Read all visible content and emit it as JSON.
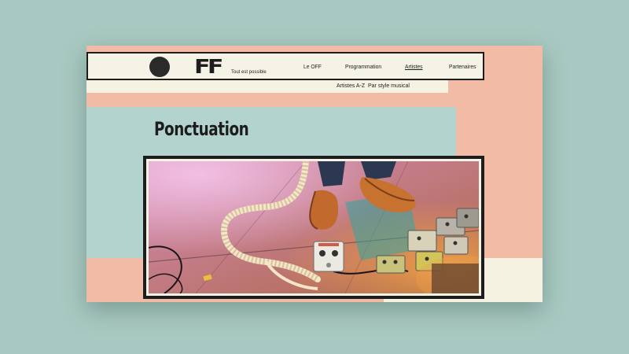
{
  "brand": {
    "mark": "FF",
    "tagline": "Tout est possible"
  },
  "nav": {
    "items": [
      {
        "label": "Le OFF"
      },
      {
        "label": "Programmation"
      },
      {
        "label": "Artistes",
        "active": true
      },
      {
        "label": "Partenaires"
      }
    ]
  },
  "subnav": {
    "items": [
      {
        "label": "Artistes A-Z"
      },
      {
        "label": "Par style musical"
      }
    ]
  },
  "page": {
    "title": "Ponctuation"
  },
  "colors": {
    "background": "#a8c9c1",
    "salmon": "#f2bba6",
    "mint": "#b3d4ce",
    "cream": "#f5f2e2",
    "ink": "#1d1d1d"
  },
  "photo": {
    "subject": "guitar-pedals-on-stage"
  }
}
